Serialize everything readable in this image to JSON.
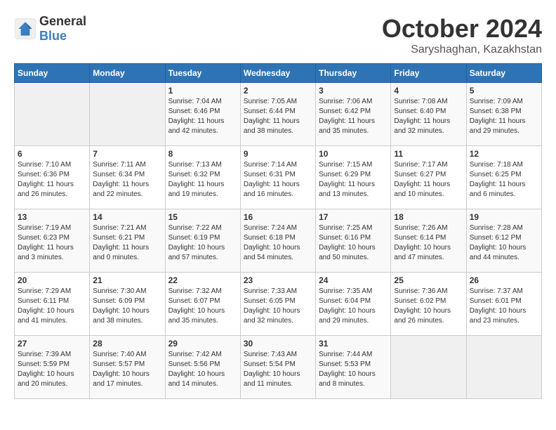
{
  "header": {
    "logo_general": "General",
    "logo_blue": "Blue",
    "month": "October 2024",
    "location": "Saryshaghan, Kazakhstan"
  },
  "weekdays": [
    "Sunday",
    "Monday",
    "Tuesday",
    "Wednesday",
    "Thursday",
    "Friday",
    "Saturday"
  ],
  "weeks": [
    [
      {
        "day": "",
        "info": ""
      },
      {
        "day": "",
        "info": ""
      },
      {
        "day": "1",
        "info": "Sunrise: 7:04 AM\nSunset: 6:46 PM\nDaylight: 11 hours and 42 minutes."
      },
      {
        "day": "2",
        "info": "Sunrise: 7:05 AM\nSunset: 6:44 PM\nDaylight: 11 hours and 38 minutes."
      },
      {
        "day": "3",
        "info": "Sunrise: 7:06 AM\nSunset: 6:42 PM\nDaylight: 11 hours and 35 minutes."
      },
      {
        "day": "4",
        "info": "Sunrise: 7:08 AM\nSunset: 6:40 PM\nDaylight: 11 hours and 32 minutes."
      },
      {
        "day": "5",
        "info": "Sunrise: 7:09 AM\nSunset: 6:38 PM\nDaylight: 11 hours and 29 minutes."
      }
    ],
    [
      {
        "day": "6",
        "info": "Sunrise: 7:10 AM\nSunset: 6:36 PM\nDaylight: 11 hours and 26 minutes."
      },
      {
        "day": "7",
        "info": "Sunrise: 7:11 AM\nSunset: 6:34 PM\nDaylight: 11 hours and 22 minutes."
      },
      {
        "day": "8",
        "info": "Sunrise: 7:13 AM\nSunset: 6:32 PM\nDaylight: 11 hours and 19 minutes."
      },
      {
        "day": "9",
        "info": "Sunrise: 7:14 AM\nSunset: 6:31 PM\nDaylight: 11 hours and 16 minutes."
      },
      {
        "day": "10",
        "info": "Sunrise: 7:15 AM\nSunset: 6:29 PM\nDaylight: 11 hours and 13 minutes."
      },
      {
        "day": "11",
        "info": "Sunrise: 7:17 AM\nSunset: 6:27 PM\nDaylight: 11 hours and 10 minutes."
      },
      {
        "day": "12",
        "info": "Sunrise: 7:18 AM\nSunset: 6:25 PM\nDaylight: 11 hours and 6 minutes."
      }
    ],
    [
      {
        "day": "13",
        "info": "Sunrise: 7:19 AM\nSunset: 6:23 PM\nDaylight: 11 hours and 3 minutes."
      },
      {
        "day": "14",
        "info": "Sunrise: 7:21 AM\nSunset: 6:21 PM\nDaylight: 11 hours and 0 minutes."
      },
      {
        "day": "15",
        "info": "Sunrise: 7:22 AM\nSunset: 6:19 PM\nDaylight: 10 hours and 57 minutes."
      },
      {
        "day": "16",
        "info": "Sunrise: 7:24 AM\nSunset: 6:18 PM\nDaylight: 10 hours and 54 minutes."
      },
      {
        "day": "17",
        "info": "Sunrise: 7:25 AM\nSunset: 6:16 PM\nDaylight: 10 hours and 50 minutes."
      },
      {
        "day": "18",
        "info": "Sunrise: 7:26 AM\nSunset: 6:14 PM\nDaylight: 10 hours and 47 minutes."
      },
      {
        "day": "19",
        "info": "Sunrise: 7:28 AM\nSunset: 6:12 PM\nDaylight: 10 hours and 44 minutes."
      }
    ],
    [
      {
        "day": "20",
        "info": "Sunrise: 7:29 AM\nSunset: 6:11 PM\nDaylight: 10 hours and 41 minutes."
      },
      {
        "day": "21",
        "info": "Sunrise: 7:30 AM\nSunset: 6:09 PM\nDaylight: 10 hours and 38 minutes."
      },
      {
        "day": "22",
        "info": "Sunrise: 7:32 AM\nSunset: 6:07 PM\nDaylight: 10 hours and 35 minutes."
      },
      {
        "day": "23",
        "info": "Sunrise: 7:33 AM\nSunset: 6:05 PM\nDaylight: 10 hours and 32 minutes."
      },
      {
        "day": "24",
        "info": "Sunrise: 7:35 AM\nSunset: 6:04 PM\nDaylight: 10 hours and 29 minutes."
      },
      {
        "day": "25",
        "info": "Sunrise: 7:36 AM\nSunset: 6:02 PM\nDaylight: 10 hours and 26 minutes."
      },
      {
        "day": "26",
        "info": "Sunrise: 7:37 AM\nSunset: 6:01 PM\nDaylight: 10 hours and 23 minutes."
      }
    ],
    [
      {
        "day": "27",
        "info": "Sunrise: 7:39 AM\nSunset: 5:59 PM\nDaylight: 10 hours and 20 minutes."
      },
      {
        "day": "28",
        "info": "Sunrise: 7:40 AM\nSunset: 5:57 PM\nDaylight: 10 hours and 17 minutes."
      },
      {
        "day": "29",
        "info": "Sunrise: 7:42 AM\nSunset: 5:56 PM\nDaylight: 10 hours and 14 minutes."
      },
      {
        "day": "30",
        "info": "Sunrise: 7:43 AM\nSunset: 5:54 PM\nDaylight: 10 hours and 11 minutes."
      },
      {
        "day": "31",
        "info": "Sunrise: 7:44 AM\nSunset: 5:53 PM\nDaylight: 10 hours and 8 minutes."
      },
      {
        "day": "",
        "info": ""
      },
      {
        "day": "",
        "info": ""
      }
    ]
  ]
}
